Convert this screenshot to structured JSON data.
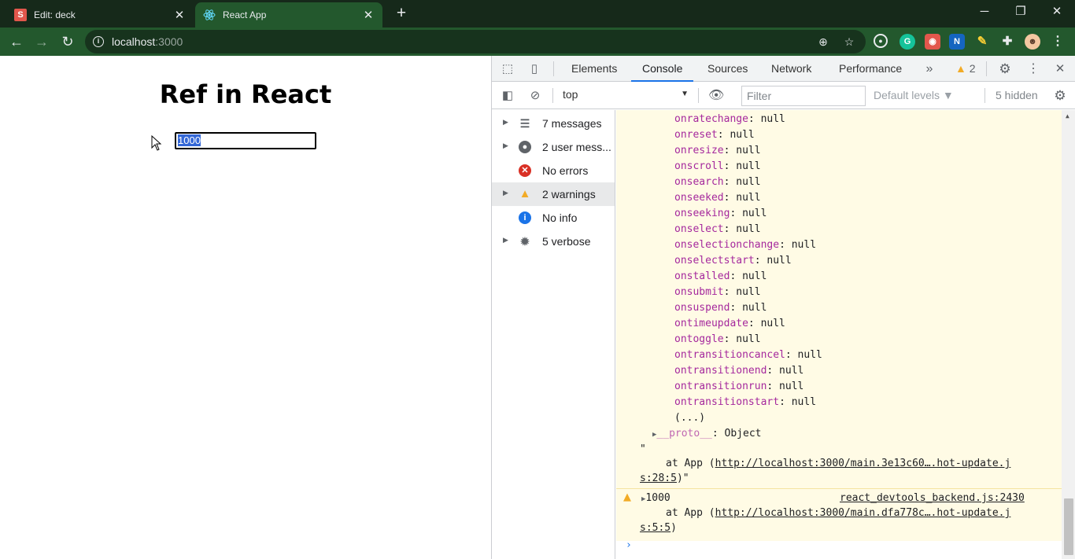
{
  "browser": {
    "tabs": [
      {
        "title": "Edit: deck",
        "favicon": "slides-icon",
        "favicon_text": "S"
      },
      {
        "title": "React App",
        "favicon": "react-icon"
      }
    ],
    "new_tab": "+",
    "window_controls": {
      "minimize": "─",
      "restore": "❐",
      "close": "✕"
    },
    "nav": {
      "back": "←",
      "forward": "→",
      "reload": "↻"
    },
    "omnibox": {
      "host": "localhost",
      "port": ":3000"
    }
  },
  "page": {
    "heading": "Ref in React",
    "input_value": "1000"
  },
  "devtools": {
    "tabs": [
      "Elements",
      "Console",
      "Sources",
      "Network",
      "Performance"
    ],
    "active_tab": "Console",
    "more_tabs": "»",
    "warning_count": "2",
    "context": "top",
    "filter_placeholder": "Filter",
    "levels": "Default levels ▼",
    "hidden": "5 hidden",
    "sidebar": [
      {
        "label": "7 messages",
        "icon": "list-icon",
        "expandable": true
      },
      {
        "label": "2 user mess...",
        "icon": "user-icon",
        "expandable": true
      },
      {
        "label": "No errors",
        "icon": "error-icon",
        "expandable": false
      },
      {
        "label": "2 warnings",
        "icon": "warning-icon",
        "expandable": true,
        "selected": true
      },
      {
        "label": "No info",
        "icon": "info-icon",
        "expandable": false
      },
      {
        "label": "5 verbose",
        "icon": "bug-icon",
        "expandable": true
      }
    ],
    "props": [
      {
        "k": "onratechange",
        "v": ": null"
      },
      {
        "k": "onreset",
        "v": ": null"
      },
      {
        "k": "onresize",
        "v": ": null"
      },
      {
        "k": "onscroll",
        "v": ": null"
      },
      {
        "k": "onsearch",
        "v": ": null"
      },
      {
        "k": "onseeked",
        "v": ": null"
      },
      {
        "k": "onseeking",
        "v": ": null"
      },
      {
        "k": "onselect",
        "v": ": null"
      },
      {
        "k": "onselectionchange",
        "v": ": null"
      },
      {
        "k": "onselectstart",
        "v": ": null"
      },
      {
        "k": "onstalled",
        "v": ": null"
      },
      {
        "k": "onsubmit",
        "v": ": null"
      },
      {
        "k": "onsuspend",
        "v": ": null"
      },
      {
        "k": "ontimeupdate",
        "v": ": null"
      },
      {
        "k": "ontoggle",
        "v": ": null"
      },
      {
        "k": "ontransitioncancel",
        "v": ": null"
      },
      {
        "k": "ontransitionend",
        "v": ": null"
      },
      {
        "k": "ontransitionrun",
        "v": ": null"
      },
      {
        "k": "ontransitionstart",
        "v": ": null"
      }
    ],
    "ellipsis": "(...)",
    "proto_key": "__proto__",
    "proto_val": ": Object",
    "quote_open": "\"",
    "stack1_prefix": "at App (",
    "stack1_link_a": "http://localhost:3000/main.3e13c60….hot-update.j",
    "stack1_link_b": "s:28:5",
    "stack1_suffix": ")\"",
    "warn_value": "1000",
    "warn_source": "react_devtools_backend.js:2430",
    "stack2_prefix": "at App (",
    "stack2_link_a": "http://localhost:3000/main.dfa778c….hot-update.j",
    "stack2_link_b": "s:5:5",
    "stack2_suffix": ")",
    "prompt": "›"
  }
}
